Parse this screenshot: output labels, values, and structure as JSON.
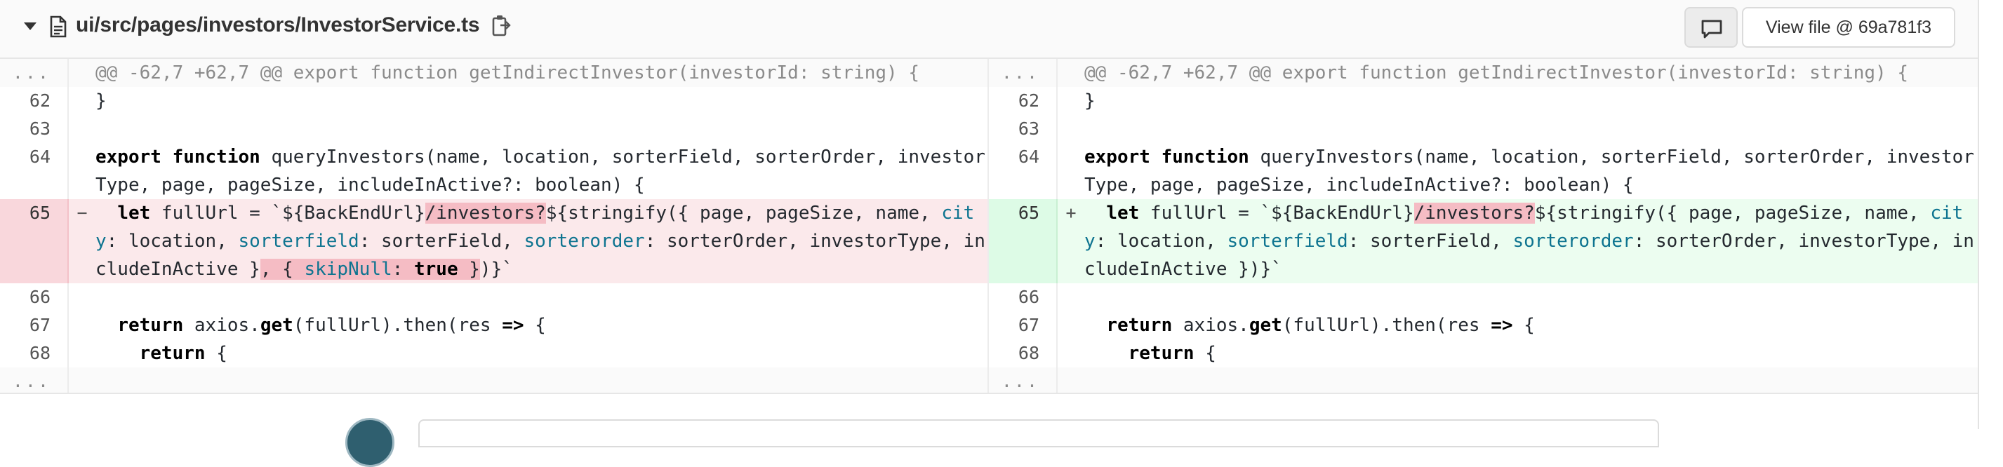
{
  "file_header": {
    "path": "ui/src/pages/investors/InvestorService.ts",
    "view_file_label": "View file @ 69a781f3"
  },
  "icons": {
    "collapse": "chevron-down-icon",
    "file": "file-icon",
    "copy": "copy-icon",
    "comment": "comment-icon"
  },
  "colors": {
    "deleted_line_bg": "#fbe9eb",
    "added_line_bg": "#ecfdf0",
    "deleted_highlight": "#f5bcc4",
    "property_color": "#0e7490"
  },
  "diff": {
    "hunk_header": "@@ -62,7 +62,7 @@ export function getIndirectInvestor(investorId: string) {",
    "expand_marker": "...",
    "line_62": "}",
    "line_64_kw": "export function",
    "line_64_rest": " queryInvestors(name, location, sorterField, sorterOrder, investor",
    "line_64_cont": "Type, page, pageSize, includeInActive?: boolean) {",
    "line_67_kw": "return",
    "line_67_a": " axios.",
    "line_67_get": "get",
    "line_67_b": "(fullUrl).then(res ",
    "line_67_arrow": "=>",
    "line_67_c": " {",
    "line_68_kw": "return",
    "line_68_rest": " {",
    "sign_removed": "−",
    "sign_added": "+",
    "changed": {
      "let_kw": "let",
      "a": " fullUrl = `${BackEndUrl}",
      "investors_seg": "/investors?",
      "b": "${stringify({ page, pageSize, name, ",
      "cit": "cit",
      "y": "y",
      "c": ": location, ",
      "sorterfield": "sorterfield",
      "d": ": sorterField, ",
      "sorterorder": "sorterorder",
      "e": ": sorterOrder, investorType, in",
      "f": "cludeInActive }",
      "removed_seg_a": ", { ",
      "skipnull": "skipNull",
      "removed_seg_b": ": ",
      "true_kw": "true",
      "removed_seg_c": " }",
      "end": ")}`"
    },
    "left_numbers": [
      "...",
      "62",
      "63",
      "64",
      "65",
      "66",
      "67",
      "68",
      "..."
    ],
    "right_numbers": [
      "...",
      "62",
      "63",
      "64",
      "65",
      "66",
      "67",
      "68",
      "..."
    ]
  }
}
